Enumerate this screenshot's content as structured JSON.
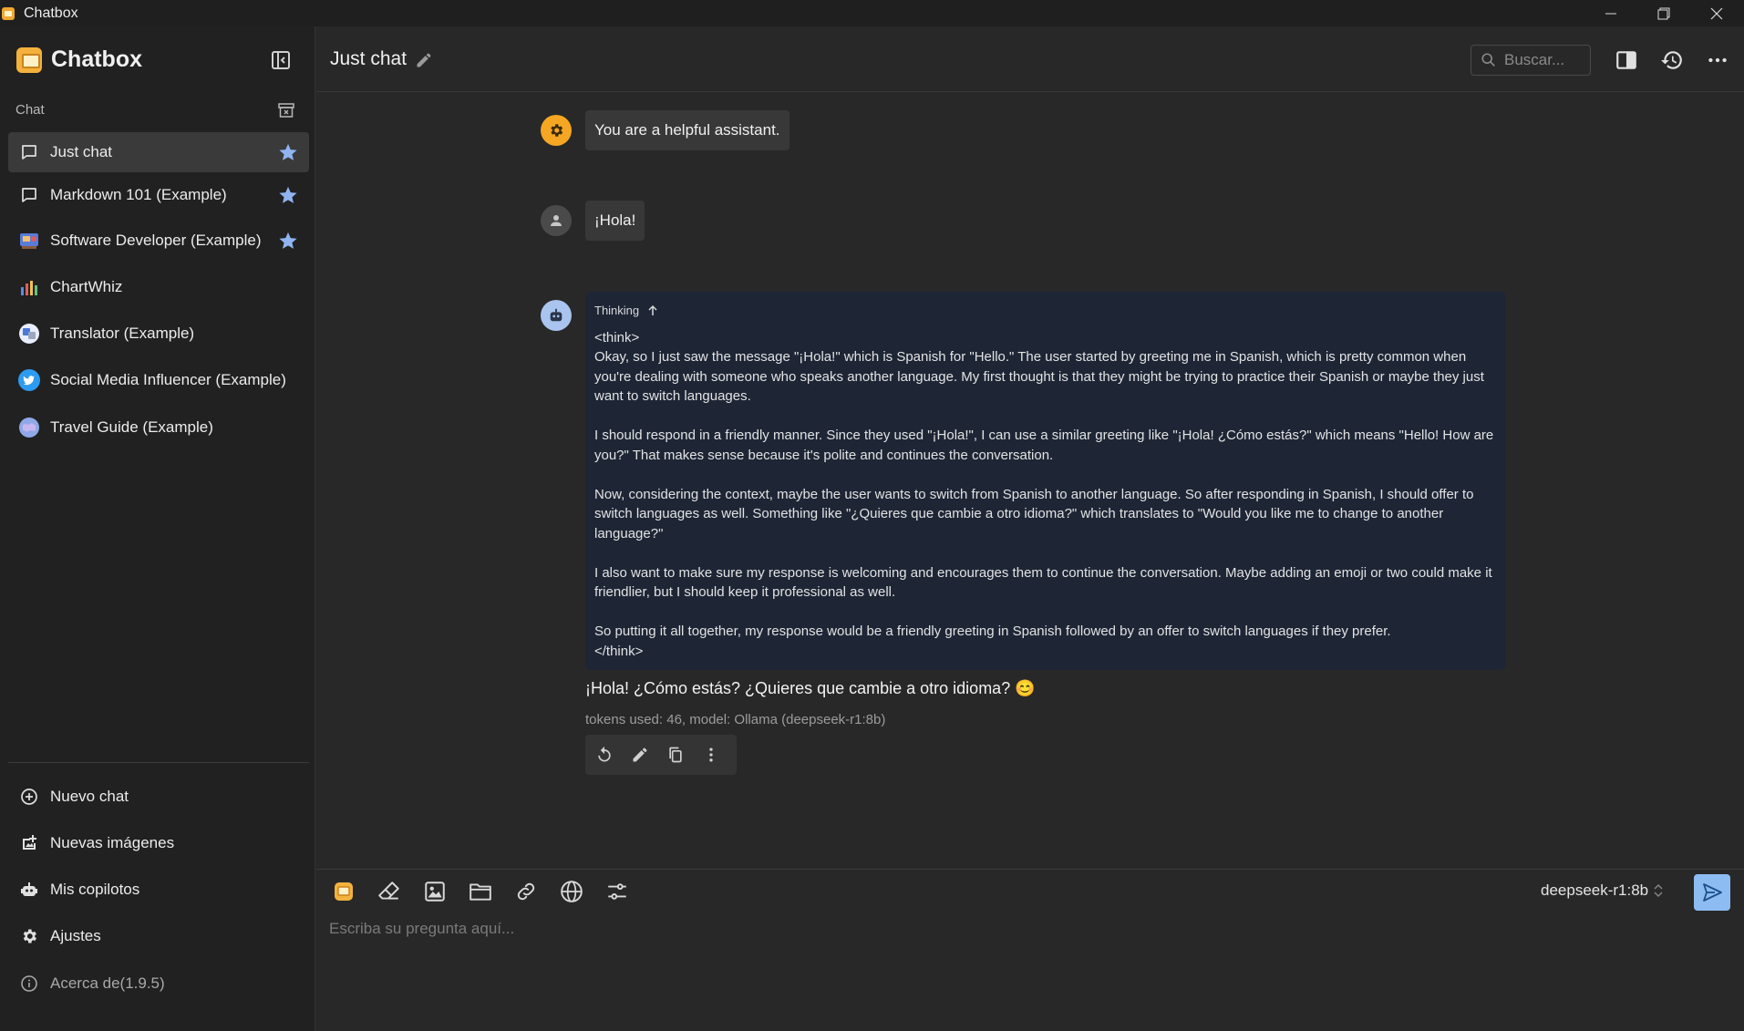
{
  "window": {
    "title": "Chatbox",
    "controls": [
      "minimize",
      "restore",
      "close"
    ]
  },
  "sidebar": {
    "brand": "Chatbox",
    "section_label": "Chat",
    "chats": [
      {
        "label": "Just chat",
        "icon": "chat-bubble-icon",
        "starred": true,
        "active": true
      },
      {
        "label": "Markdown 101 (Example)",
        "icon": "chat-bubble-icon",
        "starred": true,
        "active": false
      },
      {
        "label": "Software Developer (Example)",
        "icon": "developer-avatar",
        "starred": true,
        "active": false
      },
      {
        "label": "ChartWhiz",
        "icon": "chart-avatar",
        "starred": false,
        "active": false
      },
      {
        "label": "Translator (Example)",
        "icon": "translator-avatar",
        "starred": false,
        "active": false
      },
      {
        "label": "Social Media Influencer (Example)",
        "icon": "twitter-avatar",
        "starred": false,
        "active": false
      },
      {
        "label": "Travel Guide (Example)",
        "icon": "globe-avatar",
        "starred": false,
        "active": false
      }
    ],
    "bottom": {
      "new_chat": "Nuevo chat",
      "new_images": "Nuevas imágenes",
      "copilots": "Mis copilotos",
      "settings": "Ajustes",
      "about": "Acerca de(1.9.5)"
    }
  },
  "header": {
    "title": "Just chat",
    "search_placeholder": "Buscar..."
  },
  "messages": {
    "system": "You are a helpful assistant.",
    "user": "¡Hola!",
    "assistant": {
      "thinking_label": "Thinking",
      "think_open": "<think>",
      "paragraphs": [
        "Okay, so I just saw the message \"¡Hola!\" which is Spanish for \"Hello.\" The user started by greeting me in Spanish, which is pretty common when you're dealing with someone who speaks another language. My first thought is that they might be trying to practice their Spanish or maybe they just want to switch languages.",
        "I should respond in a friendly manner. Since they used \"¡Hola!\", I can use a similar greeting like \"¡Hola! ¿Cómo estás?\" which means \"Hello! How are you?\" That makes sense because it's polite and continues the conversation.",
        "Now, considering the context, maybe the user wants to switch from Spanish to another language. So after responding in Spanish, I should offer to switch languages as well. Something like \"¿Quieres que cambie a otro idioma?\" which translates to \"Would you like me to change to another language?\"",
        "I also want to make sure my response is welcoming and encourages them to continue the conversation. Maybe adding an emoji or two could make it friendlier, but I should keep it professional as well.",
        "So putting it all together, my response would be a friendly greeting in Spanish followed by an offer to switch languages if they prefer."
      ],
      "think_close": "</think>",
      "answer": "¡Hola! ¿Cómo estás? ¿Quieres que cambie a otro idioma? 😊",
      "meta": "tokens used: 46, model: Ollama (deepseek-r1:8b)"
    }
  },
  "composer": {
    "model": "deepseek-r1:8b",
    "placeholder": "Escriba su pregunta aquí..."
  },
  "colors": {
    "accent": "#8cbcf2",
    "star": "#90b4f0",
    "system_avatar": "#f5a623",
    "assistant_avatar": "#a9c4ef",
    "think_bg": "#1e2636"
  }
}
